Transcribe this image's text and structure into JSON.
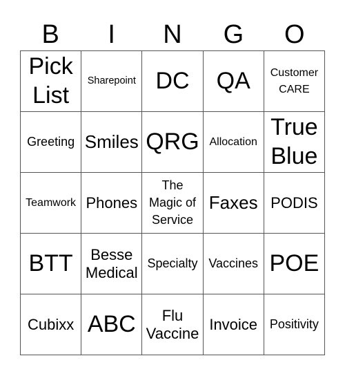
{
  "header": {
    "letters": [
      "B",
      "I",
      "N",
      "G",
      "O"
    ]
  },
  "cells": [
    {
      "text": "Pick\nList",
      "size": "xl"
    },
    {
      "text": "Sharepoint",
      "size": "xxs"
    },
    {
      "text": "DC",
      "size": "xl"
    },
    {
      "text": "QA",
      "size": "xl"
    },
    {
      "text": "Customer\nCARE",
      "size": "xs"
    },
    {
      "text": "Greeting",
      "size": "sm"
    },
    {
      "text": "Smiles",
      "size": "lg"
    },
    {
      "text": "QRG",
      "size": "xl"
    },
    {
      "text": "Allocation",
      "size": "xs"
    },
    {
      "text": "True\nBlue",
      "size": "xl"
    },
    {
      "text": "Teamwork",
      "size": "xs"
    },
    {
      "text": "Phones",
      "size": "md"
    },
    {
      "text": "The\nMagic of\nService",
      "size": "sm"
    },
    {
      "text": "Faxes",
      "size": "lg"
    },
    {
      "text": "PODIS",
      "size": "md"
    },
    {
      "text": "BTT",
      "size": "xl"
    },
    {
      "text": "Besse\nMedical",
      "size": "md"
    },
    {
      "text": "Specialty",
      "size": "sm"
    },
    {
      "text": "Vaccines",
      "size": "sm"
    },
    {
      "text": "POE",
      "size": "xl"
    },
    {
      "text": "Cubixx",
      "size": "md"
    },
    {
      "text": "ABC",
      "size": "xl"
    },
    {
      "text": "Flu\nVaccine",
      "size": "md"
    },
    {
      "text": "Invoice",
      "size": "md"
    },
    {
      "text": "Positivity",
      "size": "sm"
    }
  ]
}
